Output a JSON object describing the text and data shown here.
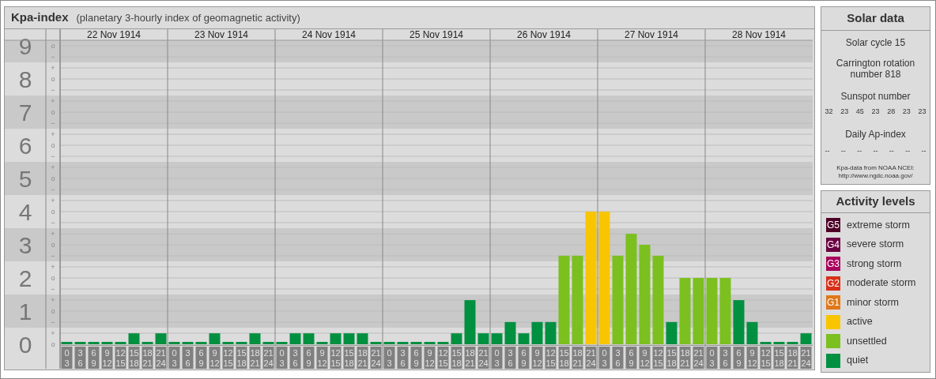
{
  "title": {
    "name": "Kpa-index",
    "subtitle": "(planetary 3-hourly index of geomagnetic activity)"
  },
  "chart": {
    "day_labels": [
      "22 Nov 1914",
      "23 Nov 1914",
      "24 Nov 1914",
      "25 Nov 1914",
      "26 Nov 1914",
      "27 Nov 1914",
      "28 Nov 1914"
    ],
    "level_marks": [
      {
        "marks": [
          "o",
          "−"
        ]
      },
      {
        "marks": [
          "+",
          "o",
          "−"
        ]
      },
      {
        "marks": [
          "+",
          "o",
          "−"
        ]
      },
      {
        "marks": [
          "+",
          "o",
          "−"
        ]
      },
      {
        "marks": [
          "+",
          "o",
          "−"
        ]
      },
      {
        "marks": [
          "+",
          "o",
          "−"
        ]
      },
      {
        "marks": [
          "+",
          "o",
          "−"
        ]
      },
      {
        "marks": [
          "+",
          "o",
          "−"
        ]
      },
      {
        "marks": [
          "+",
          "o",
          "−"
        ]
      },
      {
        "marks": [
          "+",
          "o"
        ]
      }
    ],
    "chart_data": {
      "type": "bar",
      "stacked": true,
      "grid": true,
      "ylim": [
        0,
        9
      ],
      "yticks": [
        0,
        1,
        2,
        3,
        4,
        5,
        6,
        7,
        8,
        9
      ],
      "categories": [
        "0 3",
        "3 6",
        "6 9",
        "9 12",
        "12 15",
        "15 18",
        "18 21",
        "21 24",
        "0 3",
        "3 6",
        "6 9",
        "9 12",
        "12 15",
        "15 18",
        "18 21",
        "21 24",
        "0 3",
        "3 6",
        "6 9",
        "9 12",
        "12 15",
        "15 18",
        "18 21",
        "21 24",
        "0 3",
        "3 6",
        "6 9",
        "9 12",
        "12 15",
        "15 18",
        "18 21",
        "21 24",
        "0 3",
        "3 6",
        "6 9",
        "9 12",
        "12 15",
        "15 18",
        "18 21",
        "21 24",
        "0 3",
        "3 6",
        "6 9",
        "9 12",
        "12 15",
        "15 18",
        "18 21",
        "21 24",
        "0 3",
        "3 6",
        "6 9",
        "9 12",
        "12 15",
        "15 18",
        "18 21",
        "21 24"
      ],
      "series": [
        {
          "color": "#009040",
          "values": [
            0,
            0,
            0,
            0,
            0,
            0.33,
            0,
            0.33,
            0,
            0,
            0,
            0.33,
            0,
            0,
            0.33,
            0,
            0,
            0.33,
            0.33,
            0,
            0.33,
            0.33,
            0.33,
            0,
            0,
            0,
            0,
            0,
            0,
            0.33,
            1.33,
            0.33,
            0.33,
            0.67,
            0.33,
            0.67,
            0.67,
            null,
            null,
            null,
            null,
            null,
            null,
            null,
            null,
            0.67,
            null,
            null,
            null,
            null,
            1.33,
            0.67,
            0,
            0,
            0,
            0.33
          ]
        },
        {
          "color": "#7bc01f",
          "values": [
            null,
            null,
            null,
            null,
            null,
            null,
            null,
            null,
            null,
            null,
            null,
            null,
            null,
            null,
            null,
            null,
            null,
            null,
            null,
            null,
            null,
            null,
            null,
            null,
            null,
            null,
            null,
            null,
            null,
            null,
            null,
            null,
            null,
            null,
            null,
            null,
            null,
            2.67,
            2.67,
            null,
            null,
            2.67,
            3.33,
            3,
            2.67,
            null,
            2,
            2,
            2,
            2,
            null,
            null,
            null,
            null,
            null,
            null
          ]
        },
        {
          "color": "#f8c500",
          "values": [
            null,
            null,
            null,
            null,
            null,
            null,
            null,
            null,
            null,
            null,
            null,
            null,
            null,
            null,
            null,
            null,
            null,
            null,
            null,
            null,
            null,
            null,
            null,
            null,
            null,
            null,
            null,
            null,
            null,
            null,
            null,
            null,
            null,
            null,
            null,
            null,
            null,
            null,
            null,
            4,
            4,
            null,
            null,
            null,
            null,
            null,
            null,
            null,
            null,
            null,
            null,
            null,
            null,
            null,
            null,
            null
          ]
        }
      ]
    }
  },
  "solar_data": {
    "title": "Solar data",
    "solar_cycle": "Solar cycle 15",
    "carrington": "Carrington rotation number 818",
    "sunspot_label": "Sunspot number",
    "sunspot_values": [
      "32",
      "23",
      "45",
      "23",
      "28",
      "23",
      "23"
    ],
    "ap_label": "Daily Ap-index",
    "ap_values": [
      "--",
      "--",
      "--",
      "--",
      "--",
      "--",
      "--"
    ],
    "source_lines": [
      "Kpa-data from NOAA NCEI:",
      "http://www.ngdc.noaa.gov/"
    ]
  },
  "activity_levels": {
    "title": "Activity levels",
    "items": [
      {
        "badge": "G5",
        "label": "extreme storm",
        "color": "#4d0026"
      },
      {
        "badge": "G4",
        "label": "severe storm",
        "color": "#6b0040"
      },
      {
        "badge": "G3",
        "label": "strong storm",
        "color": "#a8005c"
      },
      {
        "badge": "G2",
        "label": "moderate storm",
        "color": "#d83018"
      },
      {
        "badge": "G1",
        "label": "minor storm",
        "color": "#e07818"
      },
      {
        "label": "active",
        "color": "#f8c500"
      },
      {
        "label": "unsettled",
        "color": "#7bc01f"
      },
      {
        "label": "quiet",
        "color": "#009040"
      }
    ]
  }
}
